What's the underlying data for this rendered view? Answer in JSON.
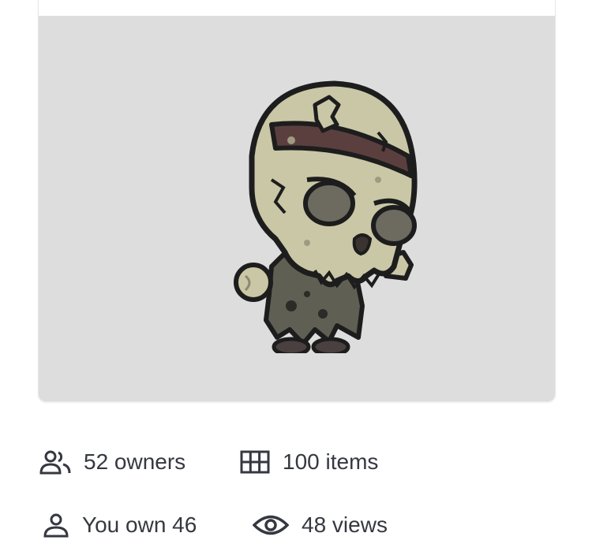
{
  "asset": {
    "image_alt": "zombie-skull-character"
  },
  "stats": {
    "owners": "52 owners",
    "items": "100 items",
    "you_own": "You own 46",
    "views": "48 views"
  },
  "icons": {
    "owners": "people-icon",
    "items": "grid-icon",
    "you_own": "person-icon",
    "views": "eye-icon"
  },
  "colors": {
    "text": "#353840",
    "media_bg": "#dddddd",
    "card_border": "#e5e8eb"
  }
}
